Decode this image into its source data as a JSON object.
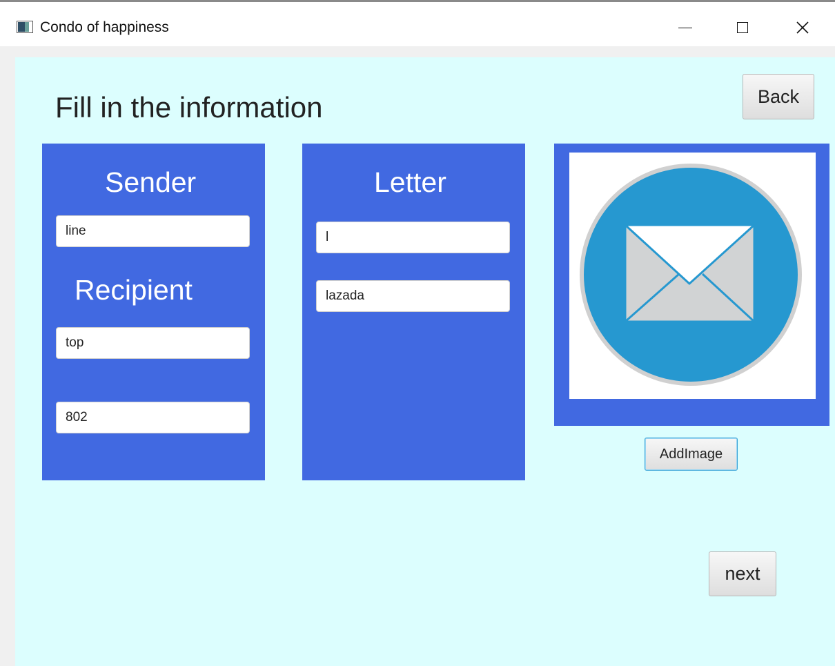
{
  "window": {
    "title": "Condo of happiness",
    "icons": {
      "app": "app-window-icon",
      "minimize": "minimize-icon",
      "maximize": "maximize-icon",
      "close": "close-icon",
      "close_glyph": "✕"
    }
  },
  "page": {
    "heading": "Fill in the information",
    "back_label": "Back",
    "next_label": "next"
  },
  "sender_panel": {
    "sender_label": "Sender",
    "sender_value": "line",
    "recipient_label": "Recipient",
    "recipient_value": "top",
    "room_value": "802"
  },
  "letter_panel": {
    "label": "Letter",
    "field1_value": "l",
    "field2_value": "lazada"
  },
  "image_panel": {
    "image_icon": "envelope-icon",
    "add_image_label": "AddImage"
  },
  "colors": {
    "background": "#dcfefe",
    "panel": "#4169e1",
    "envelope_circle": "#2698d0",
    "envelope_paper": "#d1d3d4"
  }
}
